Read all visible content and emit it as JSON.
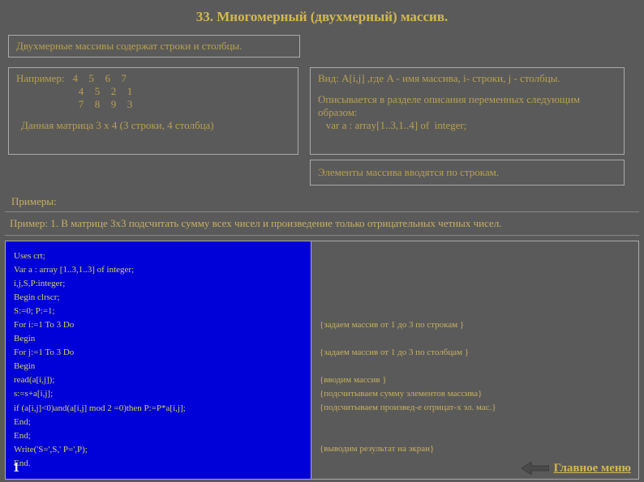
{
  "title": "33. Многомерный (двухмерный) массив.",
  "intro": "Двухмерные массивы содержат строки и столбцы.",
  "example_label": "Например:",
  "matrix": [
    [
      "4",
      "5",
      "6",
      "7"
    ],
    [
      "4",
      "5",
      "2",
      "1"
    ],
    [
      "7",
      "8",
      "9",
      "3"
    ]
  ],
  "matrix_caption": "Данная матрица 3 x 4 (3 строки, 4 столбца)",
  "right_box": {
    "line1": "Вид:  A[i,j]  ,где  A - имя массива, i- строки, j - столбцы.",
    "line2": "Описывается в разделе описания переменных следующим образом:",
    "line3": "   var a : array[1..3,1..4] of  integer;",
    "line4": "Элементы массива вводятся по строкам."
  },
  "examples_label": "Примеры:",
  "example1_label": "Пример: 1.  В матрице 3x3  подсчитать сумму всех чисел и произведение только отрицательных четных чисел.",
  "code": [
    "Uses crt;",
    "Var  a : array [1..3,1..3] of  integer;",
    "       i,j,S,P:integer;",
    "Begin  clrscr;",
    "S:=0; P:=1;",
    "For  i:=1 To 3 Do",
    "      Begin",
    "      For  j:=1 To 3 Do",
    "            Begin",
    "              read(a[i,j]);",
    "              s:=s+a[i,j];",
    "if (a[i,j]<0)and(a[i,j] mod 2 =0)then P:=P*a[i,j];",
    "          End;",
    "     End;",
    "Write('S=',S,' P=',P);",
    "End."
  ],
  "comments": {
    "c1": "{задаем массив от 1 до 3 по строкам }",
    "c2": "{задаем массив от 1 до 3 по столбцам }",
    "c3": "{вводим массив }",
    "c4": "{подсчитываем сумму элементов массива}",
    "c5": "{подсчитываем произвед-е отрицат-х эл. мас.}",
    "c6": "{выводим результат на экран}"
  },
  "page_number": "1",
  "main_menu": "Главное меню"
}
